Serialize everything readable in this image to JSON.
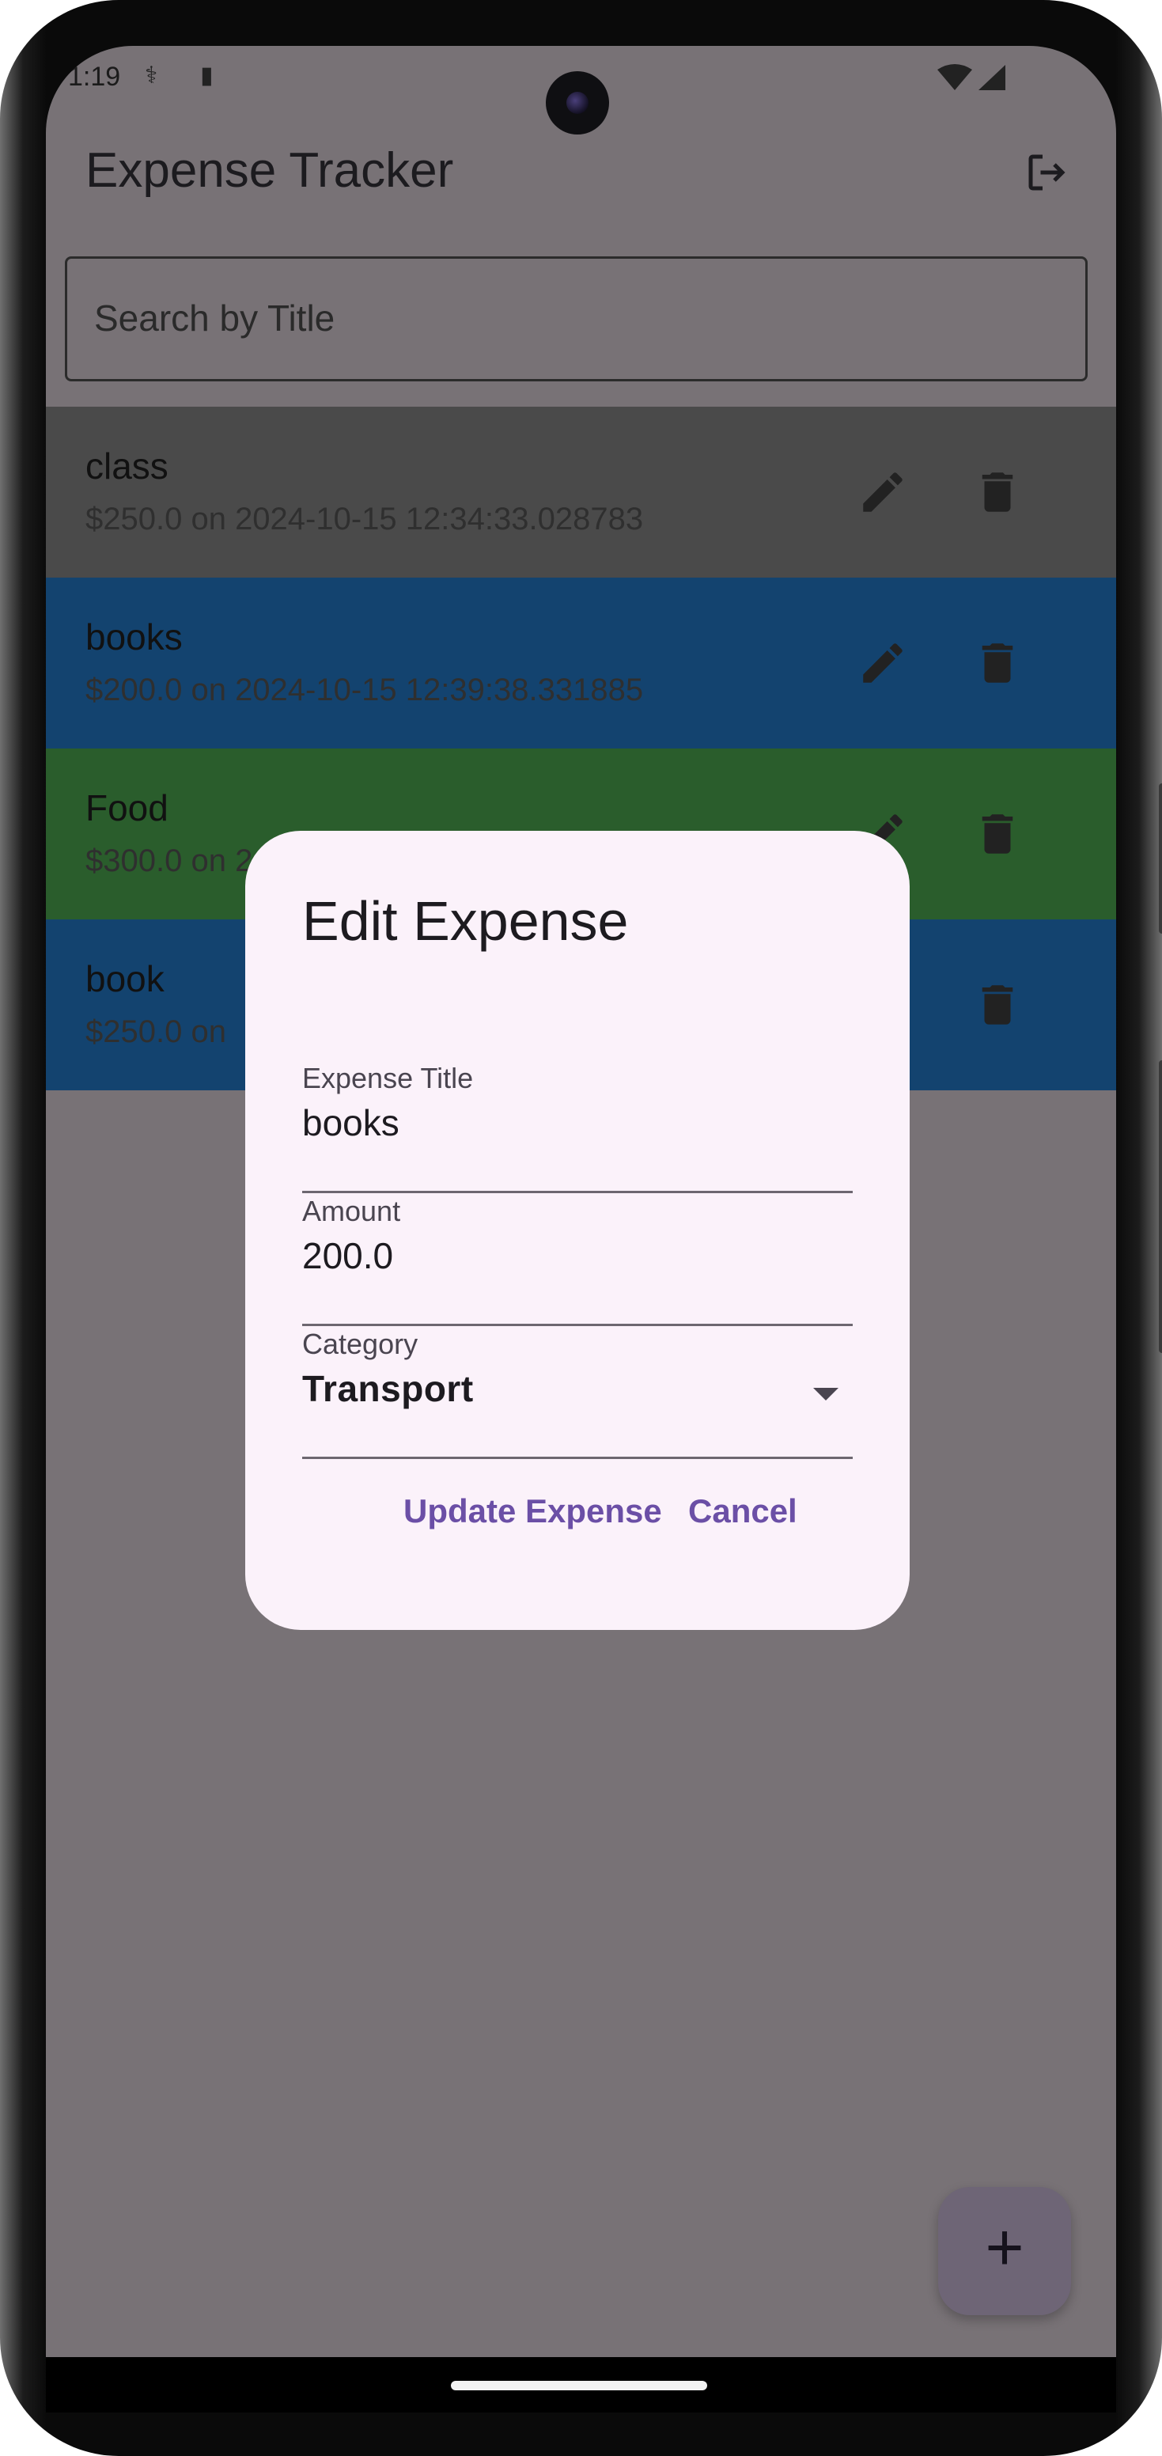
{
  "status_bar": {
    "time": "1:19"
  },
  "app": {
    "title": "Expense Tracker"
  },
  "search": {
    "placeholder": "Search by Title"
  },
  "expenses": [
    {
      "title": "class",
      "subtitle": "$250.0 on 2024-10-15 12:34:33.028783",
      "color": "#4a4a4a"
    },
    {
      "title": "books",
      "subtitle": "$200.0 on 2024-10-15 12:39:38.331885",
      "color": "#13436f"
    },
    {
      "title": "Food",
      "subtitle": "$300.0 on 2",
      "color": "#2a5d2c"
    },
    {
      "title": "book",
      "subtitle": "$250.0 on",
      "color": "#13436f"
    }
  ],
  "dialog": {
    "title": "Edit Expense",
    "title_field": {
      "label": "Expense Title",
      "value": "books"
    },
    "amount_field": {
      "label": "Amount",
      "value": "200.0"
    },
    "category_field": {
      "label": "Category",
      "value": "Transport"
    },
    "update_label": "Update Expense",
    "cancel_label": "Cancel"
  },
  "fab": {
    "label": "+"
  },
  "colors": {
    "scrim": "#787276",
    "dialog_bg": "#fbf2fa",
    "accent": "#6b4fa6"
  }
}
